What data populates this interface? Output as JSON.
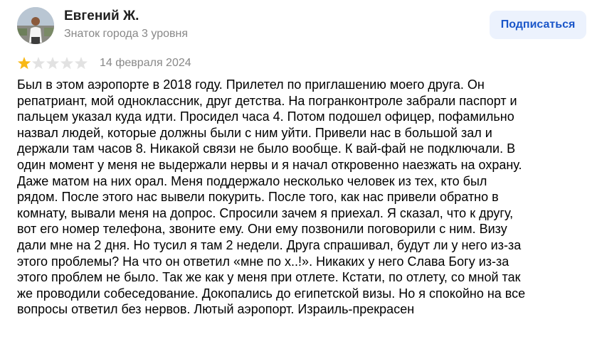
{
  "author": {
    "name": "Евгений Ж.",
    "level": "Знаток города 3 уровня"
  },
  "subscribe_label": "Подписаться",
  "rating": {
    "value": 1,
    "max": 5,
    "filled_color": "#f8b816",
    "empty_color": "#e2e2e2"
  },
  "date": "14 февраля 2024",
  "review_lines": [
    "Был в этом аэропорте в 2018 году. Прилетел по приглашению моего друга. Он",
    "репатриант, мой одноклассник, друг детства. На погранконтроле забрали паспорт и",
    "пальцем указал куда идти. Просидел часа 4. Потом подошел офицер, пофамильно",
    "назвал людей, которые должны были с ним уйти. Привели нас в большой зал и",
    "держали там часов 8. Никакой связи не было вообще. К вай-фай не подключали. В",
    "один момент у меня не выдержали нервы и я начал откровенно наезжать на охрану.",
    "Даже матом на них орал. Меня поддержало несколько человек из тех, кто был",
    "рядом. После этого нас вывели покурить. После того, как нас привели обратно в",
    "комнату, вывали меня на допрос. Спросили зачем я приехал. Я сказал, что к другу,",
    "вот его номер телефона, звоните ему. Они ему позвонили поговорили с ним. Визу",
    "дали мне на 2 дня. Но тусил я там 2 недели. Друга спрашивал, будут ли у него из-за",
    "этого проблемы? На что он ответил «мне по х..!». Никаких у него Слава Богу из-за",
    "этого проблем не было. Так же как у меня при отлете. Кстати, по отлету, со мной так",
    "же проводили собеседование. Докопались до египетской визы. Но я спокойно на все",
    "вопросы ответил без нервов. Лютый аэропорт. Израиль-прекрасен"
  ]
}
